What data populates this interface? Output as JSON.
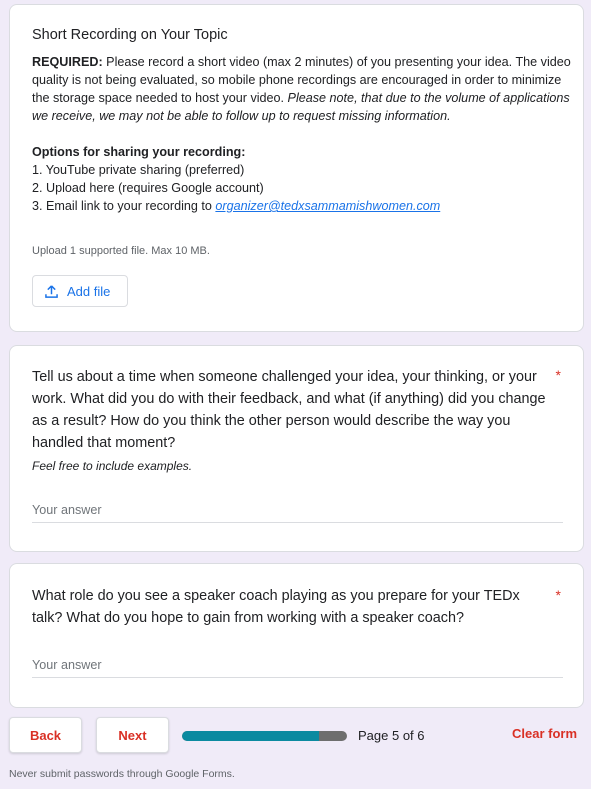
{
  "upload_section": {
    "title": "Short Recording on Your Topic",
    "required_label": "REQUIRED:",
    "required_text": " Please record a short video (max 2 minutes) of you presenting your idea. The video quality is not being evaluated, so mobile phone recordings are encouraged in order to minimize the storage space needed to host your video. ",
    "note_italic": "Please note, that due to the volume of applications we receive, we may not be able to follow up to request missing information.",
    "options_heading": "Options for sharing your recording:",
    "options": [
      "1. YouTube private sharing (preferred)",
      "2. Upload here (requires Google account)",
      "3. Email link to your recording to "
    ],
    "email": "organizer@tedxsammamishwomen.com",
    "upload_note": "Upload 1 supported file. Max 10 MB.",
    "add_file_label": "Add file"
  },
  "question_1": {
    "text": "Tell us about a time when someone challenged your idea, your thinking, or your work. What did you do with their feedback, and what (if anything) did you change as a result? How do you think the other person would describe the way you handled that moment?",
    "required_mark": "*",
    "help_text": "Feel free to include examples.",
    "placeholder": "Your answer"
  },
  "question_2": {
    "text": "What role do you see a speaker coach playing as you prepare for your TEDx talk? What do you hope to gain from working with a speaker coach?",
    "required_mark": "*",
    "placeholder": "Your answer"
  },
  "navigation": {
    "back_label": "Back",
    "next_label": "Next",
    "page_label": "Page 5 of 6",
    "progress": 0.83,
    "clear_label": "Clear form"
  },
  "footer": {
    "text": "Never submit passwords through Google Forms."
  },
  "colors": {
    "background": "#f0ebf8",
    "accent": "#d93025",
    "link": "#1a73e8",
    "progress_fill": "#0b8aa0"
  }
}
